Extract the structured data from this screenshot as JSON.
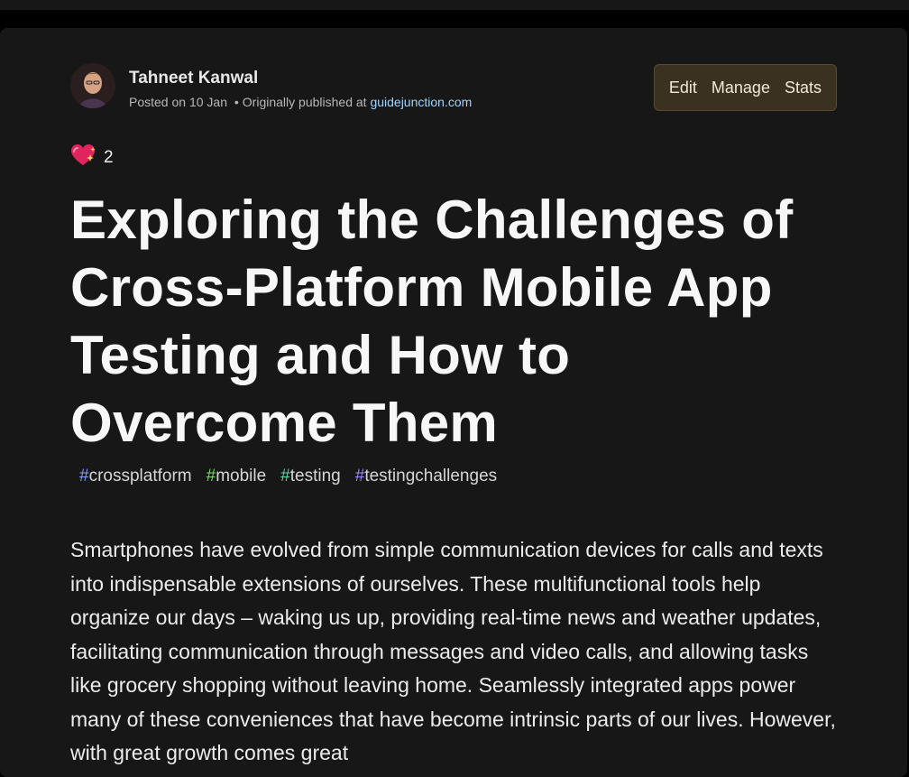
{
  "author": {
    "name": "Tahneet Kanwal",
    "posted_prefix": "Posted on",
    "posted_date": "10 Jan",
    "separator": "•",
    "originally_prefix": "Originally published at",
    "origin_link": "guidejunction.com"
  },
  "actions": {
    "edit": "Edit",
    "manage": "Manage",
    "stats": "Stats"
  },
  "reactions": {
    "icon": "sparkling-heart-icon",
    "count": "2"
  },
  "article": {
    "title": "Exploring the Challenges of Cross-Platform Mobile App Testing and How to Overcome Them",
    "tags": [
      {
        "hash": "#",
        "name": "crossplatform",
        "hash_color": "#8a9dff"
      },
      {
        "hash": "#",
        "name": "mobile",
        "hash_color": "#7bdc6a"
      },
      {
        "hash": "#",
        "name": "testing",
        "hash_color": "#56d6a5"
      },
      {
        "hash": "#",
        "name": "testingchallenges",
        "hash_color": "#9d8aff"
      }
    ],
    "body": "Smartphones have evolved from simple communication devices for calls and texts into indispensable extensions of ourselves. These multifunctional tools help organize our days – waking us up, providing real-time news and weather updates, facilitating communication through messages and video calls, and allowing tasks like grocery shopping without leaving home. Seamlessly integrated apps power many of these conveniences that have become intrinsic parts of our lives. However, with great growth comes great"
  },
  "colors": {
    "background": "#000000",
    "card": "#171717",
    "action_box": "#3a3120",
    "link": "#9fd3ff"
  }
}
